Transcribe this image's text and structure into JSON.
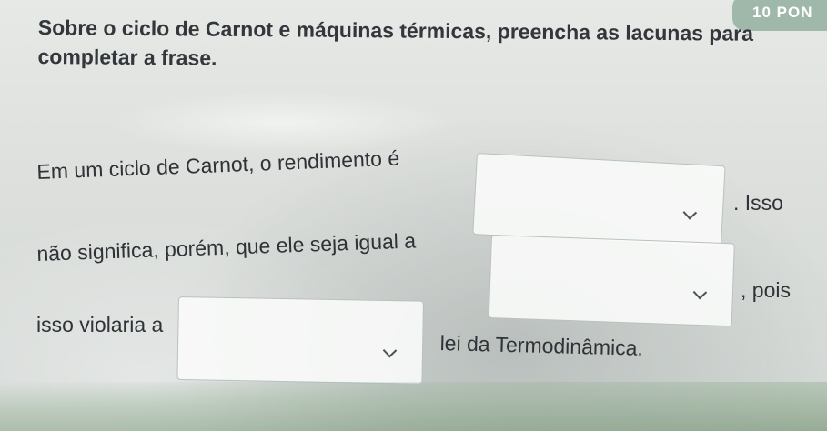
{
  "header": {
    "points": "10 PON"
  },
  "question": {
    "prompt": "Sobre o ciclo de Carnot e máquinas térmicas, preencha as lacunas para completar a frase."
  },
  "sentence": {
    "part1": "Em um ciclo de Carnot, o rendimento é",
    "part2": ". Isso",
    "part3": "não significa, porém, que ele seja igual a",
    "part4": ", pois",
    "part5": "isso violaria a",
    "part6": "lei da Termodinâmica."
  },
  "dropdowns": [
    {
      "value": ""
    },
    {
      "value": ""
    },
    {
      "value": ""
    }
  ]
}
